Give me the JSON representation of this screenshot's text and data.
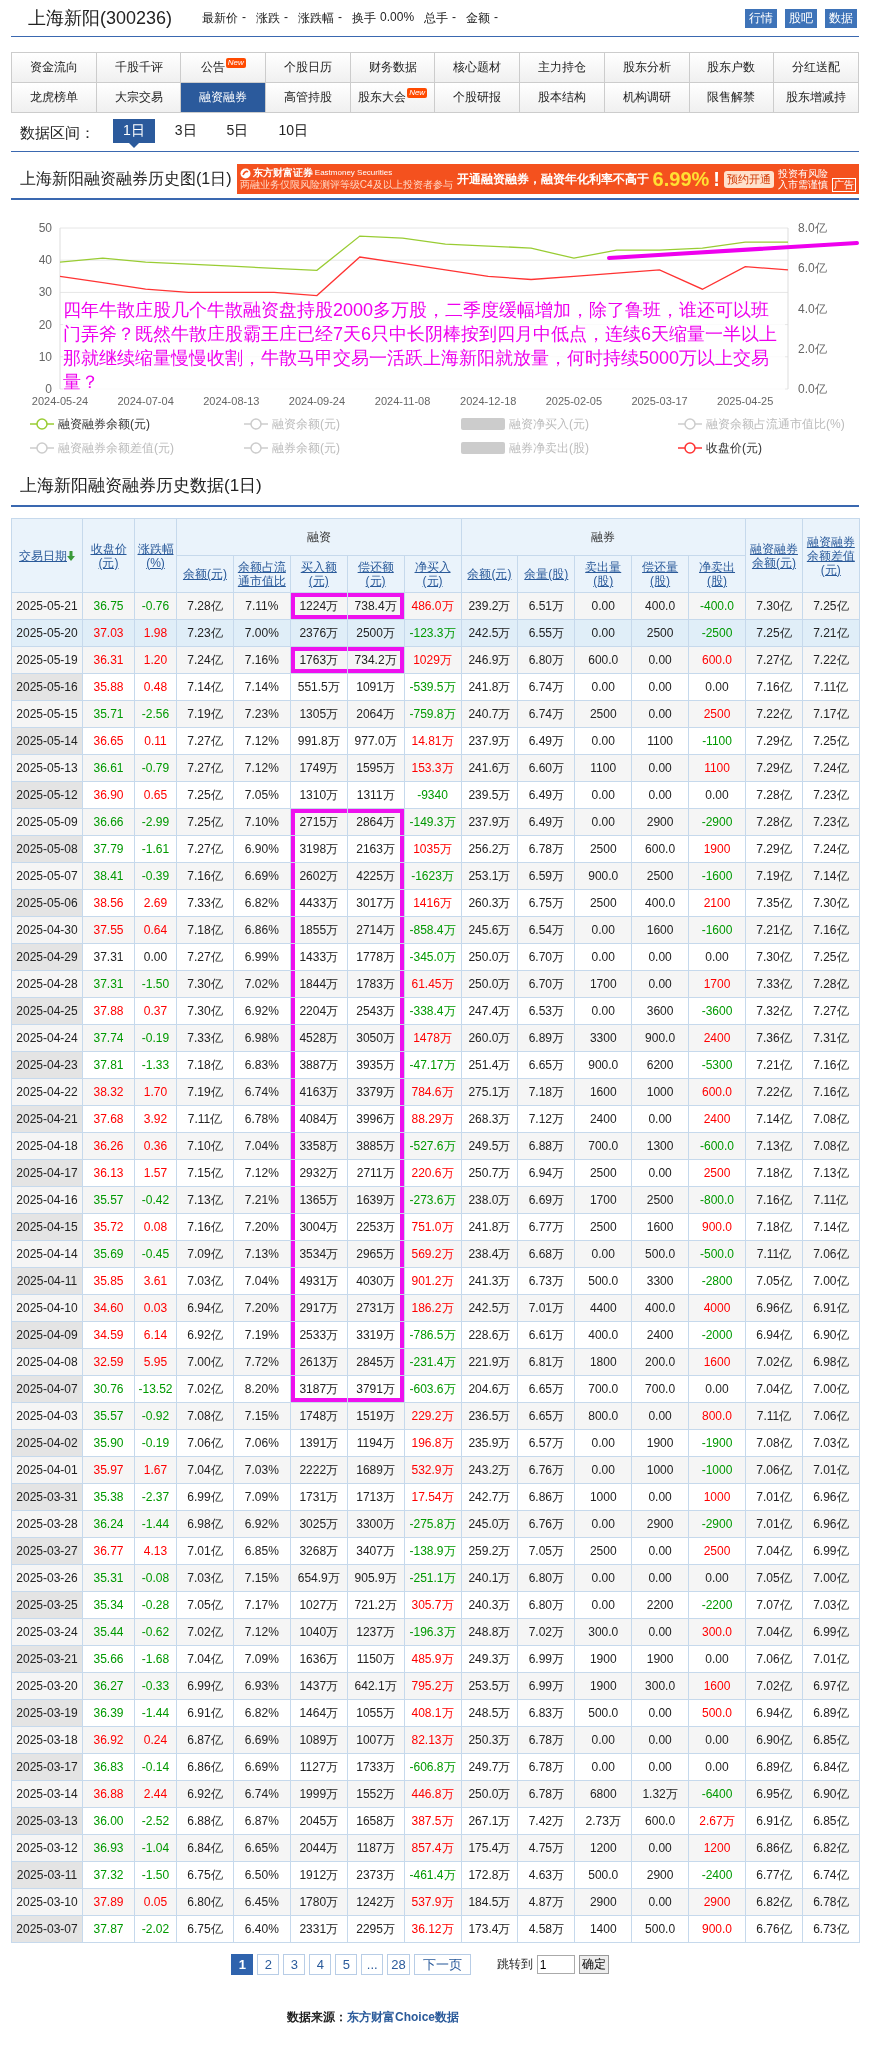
{
  "stock": {
    "name": "上海新阳(300236)",
    "quotes": [
      {
        "label": "最新价",
        "value": "-"
      },
      {
        "label": "涨跌",
        "value": "-"
      },
      {
        "label": "涨跌幅",
        "value": "-"
      },
      {
        "label": "换手",
        "value": "0.00%"
      },
      {
        "label": "总手",
        "value": "-"
      },
      {
        "label": "金额",
        "value": "-"
      }
    ],
    "buttons": [
      "行情",
      "股吧",
      "数据"
    ]
  },
  "nav": [
    {
      "label": "资金流向",
      "selected": false
    },
    {
      "label": "千股千评",
      "selected": false
    },
    {
      "label": "公告",
      "badge": "New",
      "selected": false
    },
    {
      "label": "个股日历",
      "selected": false
    },
    {
      "label": "财务数据",
      "selected": false
    },
    {
      "label": "核心题材",
      "selected": false
    },
    {
      "label": "主力持仓",
      "selected": false
    },
    {
      "label": "股东分析",
      "selected": false
    },
    {
      "label": "股东户数",
      "selected": false
    },
    {
      "label": "分红送配",
      "selected": false
    },
    {
      "label": "龙虎榜单",
      "selected": false
    },
    {
      "label": "大宗交易",
      "selected": false
    },
    {
      "label": "融资融券",
      "selected": true
    },
    {
      "label": "高管持股",
      "selected": false
    },
    {
      "label": "股东大会",
      "badge": "New",
      "selected": false
    },
    {
      "label": "个股研报",
      "selected": false
    },
    {
      "label": "股本结构",
      "selected": false
    },
    {
      "label": "机构调研",
      "selected": false
    },
    {
      "label": "限售解禁",
      "selected": false
    },
    {
      "label": "股东增减持",
      "selected": false
    }
  ],
  "period": {
    "label": "数据区间：",
    "options": [
      {
        "label": "1日",
        "selected": true
      },
      {
        "label": "3日",
        "selected": false
      },
      {
        "label": "5日",
        "selected": false
      },
      {
        "label": "10日",
        "selected": false
      }
    ]
  },
  "chart_section": {
    "title": "上海新阳融资融券历史图(1日)",
    "banner": {
      "brand": "东方财富证券",
      "brand_en": "Eastmoney Securities",
      "disclaimer": "两融业务仅限风险测评等级C4及以上投资者参与",
      "headline": "开通融资融券，融资年化利率不高于",
      "rate": "6.99%",
      "exclaim": "!",
      "button": "预约开通",
      "risk": [
        "投资有风险",
        "入市需谨慎"
      ],
      "tag": "广告"
    },
    "chart_data": {
      "type": "line",
      "grid": true,
      "categories": [
        "2024-05-24",
        null,
        "2024-07-04",
        null,
        "2024-08-13",
        null,
        "2024-09-24",
        null,
        "2024-11-08",
        null,
        "2024-12-18",
        null,
        "2025-02-05",
        null,
        "2025-03-17",
        null,
        "2025-04-25",
        null
      ],
      "ylim": [
        0,
        50
      ],
      "yticks": [
        0,
        10,
        20,
        30,
        40,
        50
      ],
      "y2lim": [
        0,
        8
      ],
      "y2ticks": [
        {
          "value": 0,
          "label": "0.0亿"
        },
        {
          "value": 2,
          "label": "2.0亿"
        },
        {
          "value": 4,
          "label": "4.0亿"
        },
        {
          "value": 6,
          "label": "6.0亿"
        },
        {
          "value": 8,
          "label": "8.0亿"
        }
      ],
      "series": [
        {
          "color": "#99cc33",
          "axis": "y2",
          "values": [
            6.3,
            6.5,
            6.3,
            6.2,
            6.1,
            6.0,
            5.9,
            7.6,
            7.5,
            7.2,
            7.1,
            7.0,
            6.5,
            6.9,
            6.9,
            7.0,
            7.3,
            7.3
          ]
        },
        {
          "color": "#ff3333",
          "values": [
            35,
            33,
            31,
            30,
            30,
            30,
            29,
            41,
            39,
            37,
            35,
            34,
            35,
            36,
            37,
            31,
            38,
            37
          ]
        }
      ]
    },
    "note": "四年牛散庄股几个牛散融资盘持股2000多万股，二季度缓幅增加，除了鲁班，谁还可以班门弄斧？既然牛散庄股霸王庄已经7天6只中长阴棒按到四月中低点，连续6天缩量一半以上那就继续缩量慢慢收割，牛散马甲交易一活跃上海新阳就放量，何时持续5000万以上交易量？",
    "legend": [
      {
        "label": "融资融券余额(元)",
        "kind": "line",
        "on": true,
        "color": "#99cc33"
      },
      {
        "label": "融资余额(元)",
        "kind": "line",
        "on": false
      },
      {
        "label": "融资净买入(元)",
        "kind": "bar",
        "on": false
      },
      {
        "label": "融资余额占流通市值比(%)",
        "kind": "line",
        "on": false
      },
      {
        "label": "融资融券余额差值(元)",
        "kind": "line",
        "on": false
      },
      {
        "label": "融券余额(元)",
        "kind": "line",
        "on": false
      },
      {
        "label": "融券净卖出(股)",
        "kind": "bar",
        "on": false
      },
      {
        "label": "收盘价(元)",
        "kind": "line",
        "on": true,
        "color": "#ff3333"
      }
    ]
  },
  "table_section": {
    "title": "上海新阳融资融券历史数据(1日)",
    "columns": [
      {
        "label": "交易日期",
        "kind": "link",
        "sorted": true
      },
      {
        "label": "收盘价(元)",
        "kind": "link",
        "sorted": false
      },
      {
        "label": "涨跌幅(%)",
        "kind": "link",
        "sorted": false
      },
      {
        "label": "融资",
        "kind": "group",
        "children": [
          {
            "label": "余额(元)",
            "kind": "link",
            "sorted": false
          },
          {
            "label": "余额占流通市值比",
            "kind": "link",
            "sorted": false
          },
          {
            "label": "买入额(元)",
            "kind": "link",
            "sorted": false
          },
          {
            "label": "偿还额(元)",
            "kind": "link",
            "sorted": false
          },
          {
            "label": "净买入(元)",
            "kind": "link",
            "sorted": false
          }
        ]
      },
      {
        "label": "融券",
        "kind": "group",
        "children": [
          {
            "label": "余额(元)",
            "kind": "link",
            "sorted": false
          },
          {
            "label": "余量(股)",
            "kind": "link",
            "sorted": false
          },
          {
            "label": "卖出量(股)",
            "kind": "link",
            "sorted": false
          },
          {
            "label": "偿还量(股)",
            "kind": "link",
            "sorted": false
          },
          {
            "label": "净卖出(股)",
            "kind": "link",
            "sorted": false
          }
        ]
      },
      {
        "label": "融资融券余额(元)",
        "kind": "link",
        "sorted": false
      },
      {
        "label": "融资融券余额差值(元)",
        "kind": "link",
        "sorted": false
      }
    ],
    "rows": [
      {
        "date": "2025-05-21",
        "close": "36.75",
        "change": "-0.76",
        "color": "#009900",
        "fin_balance": "7.28亿",
        "fin_ratio": "7.11%",
        "buy": "1224万",
        "repay": "738.4万",
        "net_buy": {
          "value": "486.0万",
          "color": "#ff0000"
        },
        "sl_balance": "239.2万",
        "sl_volume": "6.51万",
        "sell": "0.00",
        "sl_repay": "400.0",
        "net_sell": {
          "value": "-400.0",
          "color": "#009900"
        },
        "total": "7.30亿",
        "diff": "7.25亿",
        "boxed": true,
        "selected": false
      },
      {
        "date": "2025-05-20",
        "close": "37.03",
        "change": "1.98",
        "color": "#ff0000",
        "fin_balance": "7.23亿",
        "fin_ratio": "7.00%",
        "buy": "2376万",
        "repay": "2500万",
        "net_buy": {
          "value": "-123.3万",
          "color": "#009900"
        },
        "sl_balance": "242.5万",
        "sl_volume": "6.55万",
        "sell": "0.00",
        "sl_repay": "2500",
        "net_sell": {
          "value": "-2500",
          "color": "#009900"
        },
        "total": "7.25亿",
        "diff": "7.21亿",
        "boxed": false,
        "selected": true
      },
      {
        "date": "2025-05-19",
        "close": "36.31",
        "change": "1.20",
        "color": "#ff0000",
        "fin_balance": "7.24亿",
        "fin_ratio": "7.16%",
        "buy": "1763万",
        "repay": "734.2万",
        "net_buy": {
          "value": "1029万",
          "color": "#ff0000"
        },
        "sl_balance": "246.9万",
        "sl_volume": "6.80万",
        "sell": "600.0",
        "sl_repay": "0.00",
        "net_sell": {
          "value": "600.0",
          "color": "#ff0000"
        },
        "total": "7.27亿",
        "diff": "7.22亿",
        "boxed": true,
        "selected": false
      },
      {
        "date": "2025-05-16",
        "close": "35.88",
        "change": "0.48",
        "color": "#ff0000",
        "fin_balance": "7.14亿",
        "fin_ratio": "7.14%",
        "buy": "551.5万",
        "repay": "1091万",
        "net_buy": {
          "value": "-539.5万",
          "color": "#009900"
        },
        "sl_balance": "241.8万",
        "sl_volume": "6.74万",
        "sell": "0.00",
        "sl_repay": "0.00",
        "net_sell": {
          "value": "0.00",
          "color": "#222222"
        },
        "total": "7.16亿",
        "diff": "7.11亿",
        "boxed": false,
        "selected": false
      },
      {
        "date": "2025-05-15",
        "close": "35.71",
        "change": "-2.56",
        "color": "#009900",
        "fin_balance": "7.19亿",
        "fin_ratio": "7.23%",
        "buy": "1305万",
        "repay": "2064万",
        "net_buy": {
          "value": "-759.8万",
          "color": "#009900"
        },
        "sl_balance": "240.7万",
        "sl_volume": "6.74万",
        "sell": "2500",
        "sl_repay": "0.00",
        "net_sell": {
          "value": "2500",
          "color": "#ff0000"
        },
        "total": "7.22亿",
        "diff": "7.17亿",
        "boxed": false,
        "selected": false
      },
      {
        "date": "2025-05-14",
        "close": "36.65",
        "change": "0.11",
        "color": "#ff0000",
        "fin_balance": "7.27亿",
        "fin_ratio": "7.12%",
        "buy": "991.8万",
        "repay": "977.0万",
        "net_buy": {
          "value": "14.81万",
          "color": "#ff0000"
        },
        "sl_balance": "237.9万",
        "sl_volume": "6.49万",
        "sell": "0.00",
        "sl_repay": "1100",
        "net_sell": {
          "value": "-1100",
          "color": "#009900"
        },
        "total": "7.29亿",
        "diff": "7.25亿",
        "boxed": false,
        "selected": false
      },
      {
        "date": "2025-05-13",
        "close": "36.61",
        "change": "-0.79",
        "color": "#009900",
        "fin_balance": "7.27亿",
        "fin_ratio": "7.12%",
        "buy": "1749万",
        "repay": "1595万",
        "net_buy": {
          "value": "153.3万",
          "color": "#ff0000"
        },
        "sl_balance": "241.6万",
        "sl_volume": "6.60万",
        "sell": "1100",
        "sl_repay": "0.00",
        "net_sell": {
          "value": "1100",
          "color": "#ff0000"
        },
        "total": "7.29亿",
        "diff": "7.24亿",
        "boxed": false,
        "selected": false
      },
      {
        "date": "2025-05-12",
        "close": "36.90",
        "change": "0.65",
        "color": "#ff0000",
        "fin_balance": "7.25亿",
        "fin_ratio": "7.05%",
        "buy": "1310万",
        "repay": "1311万",
        "net_buy": {
          "value": "-9340",
          "color": "#009900"
        },
        "sl_balance": "239.5万",
        "sl_volume": "6.49万",
        "sell": "0.00",
        "sl_repay": "0.00",
        "net_sell": {
          "value": "0.00",
          "color": "#222222"
        },
        "total": "7.28亿",
        "diff": "7.23亿",
        "boxed": false,
        "selected": false
      },
      {
        "date": "2025-05-09",
        "close": "36.66",
        "change": "-2.99",
        "color": "#009900",
        "fin_balance": "7.25亿",
        "fin_ratio": "7.10%",
        "buy": "2715万",
        "repay": "2864万",
        "net_buy": {
          "value": "-149.3万",
          "color": "#009900"
        },
        "sl_balance": "237.9万",
        "sl_volume": "6.49万",
        "sell": "0.00",
        "sl_repay": "2900",
        "net_sell": {
          "value": "-2900",
          "color": "#009900"
        },
        "total": "7.28亿",
        "diff": "7.23亿",
        "boxed": true,
        "selected": false
      },
      {
        "date": "2025-05-08",
        "close": "37.79",
        "change": "-1.61",
        "color": "#009900",
        "fin_balance": "7.27亿",
        "fin_ratio": "6.90%",
        "buy": "3198万",
        "repay": "2163万",
        "net_buy": {
          "value": "1035万",
          "color": "#ff0000"
        },
        "sl_balance": "256.2万",
        "sl_volume": "6.78万",
        "sell": "2500",
        "sl_repay": "600.0",
        "net_sell": {
          "value": "1900",
          "color": "#ff0000"
        },
        "total": "7.29亿",
        "diff": "7.24亿",
        "boxed": true,
        "selected": false
      },
      {
        "date": "2025-05-07",
        "close": "38.41",
        "change": "-0.39",
        "color": "#009900",
        "fin_balance": "7.16亿",
        "fin_ratio": "6.69%",
        "buy": "2602万",
        "repay": "4225万",
        "net_buy": {
          "value": "-1623万",
          "color": "#009900"
        },
        "sl_balance": "253.1万",
        "sl_volume": "6.59万",
        "sell": "900.0",
        "sl_repay": "2500",
        "net_sell": {
          "value": "-1600",
          "color": "#009900"
        },
        "total": "7.19亿",
        "diff": "7.14亿",
        "boxed": true,
        "selected": false
      },
      {
        "date": "2025-05-06",
        "close": "38.56",
        "change": "2.69",
        "color": "#ff0000",
        "fin_balance": "7.33亿",
        "fin_ratio": "6.82%",
        "buy": "4433万",
        "repay": "3017万",
        "net_buy": {
          "value": "1416万",
          "color": "#ff0000"
        },
        "sl_balance": "260.3万",
        "sl_volume": "6.75万",
        "sell": "2500",
        "sl_repay": "400.0",
        "net_sell": {
          "value": "2100",
          "color": "#ff0000"
        },
        "total": "7.35亿",
        "diff": "7.30亿",
        "boxed": true,
        "selected": false
      },
      {
        "date": "2025-04-30",
        "close": "37.55",
        "change": "0.64",
        "color": "#ff0000",
        "fin_balance": "7.18亿",
        "fin_ratio": "6.86%",
        "buy": "1855万",
        "repay": "2714万",
        "net_buy": {
          "value": "-858.4万",
          "color": "#009900"
        },
        "sl_balance": "245.6万",
        "sl_volume": "6.54万",
        "sell": "0.00",
        "sl_repay": "1600",
        "net_sell": {
          "value": "-1600",
          "color": "#009900"
        },
        "total": "7.21亿",
        "diff": "7.16亿",
        "boxed": true,
        "selected": false
      },
      {
        "date": "2025-04-29",
        "close": "37.31",
        "change": "0.00",
        "color": "#222222",
        "fin_balance": "7.27亿",
        "fin_ratio": "6.99%",
        "buy": "1433万",
        "repay": "1778万",
        "net_buy": {
          "value": "-345.0万",
          "color": "#009900"
        },
        "sl_balance": "250.0万",
        "sl_volume": "6.70万",
        "sell": "0.00",
        "sl_repay": "0.00",
        "net_sell": {
          "value": "0.00",
          "color": "#222222"
        },
        "total": "7.30亿",
        "diff": "7.25亿",
        "boxed": true,
        "selected": false
      },
      {
        "date": "2025-04-28",
        "close": "37.31",
        "change": "-1.50",
        "color": "#009900",
        "fin_balance": "7.30亿",
        "fin_ratio": "7.02%",
        "buy": "1844万",
        "repay": "1783万",
        "net_buy": {
          "value": "61.45万",
          "color": "#ff0000"
        },
        "sl_balance": "250.0万",
        "sl_volume": "6.70万",
        "sell": "1700",
        "sl_repay": "0.00",
        "net_sell": {
          "value": "1700",
          "color": "#ff0000"
        },
        "total": "7.33亿",
        "diff": "7.28亿",
        "boxed": true,
        "selected": false
      },
      {
        "date": "2025-04-25",
        "close": "37.88",
        "change": "0.37",
        "color": "#ff0000",
        "fin_balance": "7.30亿",
        "fin_ratio": "6.92%",
        "buy": "2204万",
        "repay": "2543万",
        "net_buy": {
          "value": "-338.4万",
          "color": "#009900"
        },
        "sl_balance": "247.4万",
        "sl_volume": "6.53万",
        "sell": "0.00",
        "sl_repay": "3600",
        "net_sell": {
          "value": "-3600",
          "color": "#009900"
        },
        "total": "7.32亿",
        "diff": "7.27亿",
        "boxed": true,
        "selected": false
      },
      {
        "date": "2025-04-24",
        "close": "37.74",
        "change": "-0.19",
        "color": "#009900",
        "fin_balance": "7.33亿",
        "fin_ratio": "6.98%",
        "buy": "4528万",
        "repay": "3050万",
        "net_buy": {
          "value": "1478万",
          "color": "#ff0000"
        },
        "sl_balance": "260.0万",
        "sl_volume": "6.89万",
        "sell": "3300",
        "sl_repay": "900.0",
        "net_sell": {
          "value": "2400",
          "color": "#ff0000"
        },
        "total": "7.36亿",
        "diff": "7.31亿",
        "boxed": true,
        "selected": false
      },
      {
        "date": "2025-04-23",
        "close": "37.81",
        "change": "-1.33",
        "color": "#009900",
        "fin_balance": "7.18亿",
        "fin_ratio": "6.83%",
        "buy": "3887万",
        "repay": "3935万",
        "net_buy": {
          "value": "-47.17万",
          "color": "#009900"
        },
        "sl_balance": "251.4万",
        "sl_volume": "6.65万",
        "sell": "900.0",
        "sl_repay": "6200",
        "net_sell": {
          "value": "-5300",
          "color": "#009900"
        },
        "total": "7.21亿",
        "diff": "7.16亿",
        "boxed": true,
        "selected": false
      },
      {
        "date": "2025-04-22",
        "close": "38.32",
        "change": "1.70",
        "color": "#ff0000",
        "fin_balance": "7.19亿",
        "fin_ratio": "6.74%",
        "buy": "4163万",
        "repay": "3379万",
        "net_buy": {
          "value": "784.6万",
          "color": "#ff0000"
        },
        "sl_balance": "275.1万",
        "sl_volume": "7.18万",
        "sell": "1600",
        "sl_repay": "1000",
        "net_sell": {
          "value": "600.0",
          "color": "#ff0000"
        },
        "total": "7.22亿",
        "diff": "7.16亿",
        "boxed": true,
        "selected": false
      },
      {
        "date": "2025-04-21",
        "close": "37.68",
        "change": "3.92",
        "color": "#ff0000",
        "fin_balance": "7.11亿",
        "fin_ratio": "6.78%",
        "buy": "4084万",
        "repay": "3996万",
        "net_buy": {
          "value": "88.29万",
          "color": "#ff0000"
        },
        "sl_balance": "268.3万",
        "sl_volume": "7.12万",
        "sell": "2400",
        "sl_repay": "0.00",
        "net_sell": {
          "value": "2400",
          "color": "#ff0000"
        },
        "total": "7.14亿",
        "diff": "7.08亿",
        "boxed": true,
        "selected": false
      },
      {
        "date": "2025-04-18",
        "close": "36.26",
        "change": "0.36",
        "color": "#ff0000",
        "fin_balance": "7.10亿",
        "fin_ratio": "7.04%",
        "buy": "3358万",
        "repay": "3885万",
        "net_buy": {
          "value": "-527.6万",
          "color": "#009900"
        },
        "sl_balance": "249.5万",
        "sl_volume": "6.88万",
        "sell": "700.0",
        "sl_repay": "1300",
        "net_sell": {
          "value": "-600.0",
          "color": "#009900"
        },
        "total": "7.13亿",
        "diff": "7.08亿",
        "boxed": true,
        "selected": false
      },
      {
        "date": "2025-04-17",
        "close": "36.13",
        "change": "1.57",
        "color": "#ff0000",
        "fin_balance": "7.15亿",
        "fin_ratio": "7.12%",
        "buy": "2932万",
        "repay": "2711万",
        "net_buy": {
          "value": "220.6万",
          "color": "#ff0000"
        },
        "sl_balance": "250.7万",
        "sl_volume": "6.94万",
        "sell": "2500",
        "sl_repay": "0.00",
        "net_sell": {
          "value": "2500",
          "color": "#ff0000"
        },
        "total": "7.18亿",
        "diff": "7.13亿",
        "boxed": true,
        "selected": false
      },
      {
        "date": "2025-04-16",
        "close": "35.57",
        "change": "-0.42",
        "color": "#009900",
        "fin_balance": "7.13亿",
        "fin_ratio": "7.21%",
        "buy": "1365万",
        "repay": "1639万",
        "net_buy": {
          "value": "-273.6万",
          "color": "#009900"
        },
        "sl_balance": "238.0万",
        "sl_volume": "6.69万",
        "sell": "1700",
        "sl_repay": "2500",
        "net_sell": {
          "value": "-800.0",
          "color": "#009900"
        },
        "total": "7.16亿",
        "diff": "7.11亿",
        "boxed": true,
        "selected": false
      },
      {
        "date": "2025-04-15",
        "close": "35.72",
        "change": "0.08",
        "color": "#ff0000",
        "fin_balance": "7.16亿",
        "fin_ratio": "7.20%",
        "buy": "3004万",
        "repay": "2253万",
        "net_buy": {
          "value": "751.0万",
          "color": "#ff0000"
        },
        "sl_balance": "241.8万",
        "sl_volume": "6.77万",
        "sell": "2500",
        "sl_repay": "1600",
        "net_sell": {
          "value": "900.0",
          "color": "#ff0000"
        },
        "total": "7.18亿",
        "diff": "7.14亿",
        "boxed": true,
        "selected": false
      },
      {
        "date": "2025-04-14",
        "close": "35.69",
        "change": "-0.45",
        "color": "#009900",
        "fin_balance": "7.09亿",
        "fin_ratio": "7.13%",
        "buy": "3534万",
        "repay": "2965万",
        "net_buy": {
          "value": "569.2万",
          "color": "#ff0000"
        },
        "sl_balance": "238.4万",
        "sl_volume": "6.68万",
        "sell": "0.00",
        "sl_repay": "500.0",
        "net_sell": {
          "value": "-500.0",
          "color": "#009900"
        },
        "total": "7.11亿",
        "diff": "7.06亿",
        "boxed": true,
        "selected": false
      },
      {
        "date": "2025-04-11",
        "close": "35.85",
        "change": "3.61",
        "color": "#ff0000",
        "fin_balance": "7.03亿",
        "fin_ratio": "7.04%",
        "buy": "4931万",
        "repay": "4030万",
        "net_buy": {
          "value": "901.2万",
          "color": "#ff0000"
        },
        "sl_balance": "241.3万",
        "sl_volume": "6.73万",
        "sell": "500.0",
        "sl_repay": "3300",
        "net_sell": {
          "value": "-2800",
          "color": "#009900"
        },
        "total": "7.05亿",
        "diff": "7.00亿",
        "boxed": true,
        "selected": false
      },
      {
        "date": "2025-04-10",
        "close": "34.60",
        "change": "0.03",
        "color": "#ff0000",
        "fin_balance": "6.94亿",
        "fin_ratio": "7.20%",
        "buy": "2917万",
        "repay": "2731万",
        "net_buy": {
          "value": "186.2万",
          "color": "#ff0000"
        },
        "sl_balance": "242.5万",
        "sl_volume": "7.01万",
        "sell": "4400",
        "sl_repay": "400.0",
        "net_sell": {
          "value": "4000",
          "color": "#ff0000"
        },
        "total": "6.96亿",
        "diff": "6.91亿",
        "boxed": true,
        "selected": false
      },
      {
        "date": "2025-04-09",
        "close": "34.59",
        "change": "6.14",
        "color": "#ff0000",
        "fin_balance": "6.92亿",
        "fin_ratio": "7.19%",
        "buy": "2533万",
        "repay": "3319万",
        "net_buy": {
          "value": "-786.5万",
          "color": "#009900"
        },
        "sl_balance": "228.6万",
        "sl_volume": "6.61万",
        "sell": "400.0",
        "sl_repay": "2400",
        "net_sell": {
          "value": "-2000",
          "color": "#009900"
        },
        "total": "6.94亿",
        "diff": "6.90亿",
        "boxed": true,
        "selected": false
      },
      {
        "date": "2025-04-08",
        "close": "32.59",
        "change": "5.95",
        "color": "#ff0000",
        "fin_balance": "7.00亿",
        "fin_ratio": "7.72%",
        "buy": "2613万",
        "repay": "2845万",
        "net_buy": {
          "value": "-231.4万",
          "color": "#009900"
        },
        "sl_balance": "221.9万",
        "sl_volume": "6.81万",
        "sell": "1800",
        "sl_repay": "200.0",
        "net_sell": {
          "value": "1600",
          "color": "#ff0000"
        },
        "total": "7.02亿",
        "diff": "6.98亿",
        "boxed": true,
        "selected": false
      },
      {
        "date": "2025-04-07",
        "close": "30.76",
        "change": "-13.52",
        "color": "#009900",
        "fin_balance": "7.02亿",
        "fin_ratio": "8.20%",
        "buy": "3187万",
        "repay": "3791万",
        "net_buy": {
          "value": "-603.6万",
          "color": "#009900"
        },
        "sl_balance": "204.6万",
        "sl_volume": "6.65万",
        "sell": "700.0",
        "sl_repay": "700.0",
        "net_sell": {
          "value": "0.00",
          "color": "#222222"
        },
        "total": "7.04亿",
        "diff": "7.00亿",
        "boxed": true,
        "selected": false
      },
      {
        "date": "2025-04-03",
        "close": "35.57",
        "change": "-0.92",
        "color": "#009900",
        "fin_balance": "7.08亿",
        "fin_ratio": "7.15%",
        "buy": "1748万",
        "repay": "1519万",
        "net_buy": {
          "value": "229.2万",
          "color": "#ff0000"
        },
        "sl_balance": "236.5万",
        "sl_volume": "6.65万",
        "sell": "800.0",
        "sl_repay": "0.00",
        "net_sell": {
          "value": "800.0",
          "color": "#ff0000"
        },
        "total": "7.11亿",
        "diff": "7.06亿",
        "boxed": false,
        "selected": false
      },
      {
        "date": "2025-04-02",
        "close": "35.90",
        "change": "-0.19",
        "color": "#009900",
        "fin_balance": "7.06亿",
        "fin_ratio": "7.06%",
        "buy": "1391万",
        "repay": "1194万",
        "net_buy": {
          "value": "196.8万",
          "color": "#ff0000"
        },
        "sl_balance": "235.9万",
        "sl_volume": "6.57万",
        "sell": "0.00",
        "sl_repay": "1900",
        "net_sell": {
          "value": "-1900",
          "color": "#009900"
        },
        "total": "7.08亿",
        "diff": "7.03亿",
        "boxed": false,
        "selected": false
      },
      {
        "date": "2025-04-01",
        "close": "35.97",
        "change": "1.67",
        "color": "#ff0000",
        "fin_balance": "7.04亿",
        "fin_ratio": "7.03%",
        "buy": "2222万",
        "repay": "1689万",
        "net_buy": {
          "value": "532.9万",
          "color": "#ff0000"
        },
        "sl_balance": "243.2万",
        "sl_volume": "6.76万",
        "sell": "0.00",
        "sl_repay": "1000",
        "net_sell": {
          "value": "-1000",
          "color": "#009900"
        },
        "total": "7.06亿",
        "diff": "7.01亿",
        "boxed": false,
        "selected": false
      },
      {
        "date": "2025-03-31",
        "close": "35.38",
        "change": "-2.37",
        "color": "#009900",
        "fin_balance": "6.99亿",
        "fin_ratio": "7.09%",
        "buy": "1731万",
        "repay": "1713万",
        "net_buy": {
          "value": "17.54万",
          "color": "#ff0000"
        },
        "sl_balance": "242.7万",
        "sl_volume": "6.86万",
        "sell": "1000",
        "sl_repay": "0.00",
        "net_sell": {
          "value": "1000",
          "color": "#ff0000"
        },
        "total": "7.01亿",
        "diff": "6.96亿",
        "boxed": false,
        "selected": false
      },
      {
        "date": "2025-03-28",
        "close": "36.24",
        "change": "-1.44",
        "color": "#009900",
        "fin_balance": "6.98亿",
        "fin_ratio": "6.92%",
        "buy": "3025万",
        "repay": "3300万",
        "net_buy": {
          "value": "-275.8万",
          "color": "#009900"
        },
        "sl_balance": "245.0万",
        "sl_volume": "6.76万",
        "sell": "0.00",
        "sl_repay": "2900",
        "net_sell": {
          "value": "-2900",
          "color": "#009900"
        },
        "total": "7.01亿",
        "diff": "6.96亿",
        "boxed": false,
        "selected": false
      },
      {
        "date": "2025-03-27",
        "close": "36.77",
        "change": "4.13",
        "color": "#ff0000",
        "fin_balance": "7.01亿",
        "fin_ratio": "6.85%",
        "buy": "3268万",
        "repay": "3407万",
        "net_buy": {
          "value": "-138.9万",
          "color": "#009900"
        },
        "sl_balance": "259.2万",
        "sl_volume": "7.05万",
        "sell": "2500",
        "sl_repay": "0.00",
        "net_sell": {
          "value": "2500",
          "color": "#ff0000"
        },
        "total": "7.04亿",
        "diff": "6.99亿",
        "boxed": false,
        "selected": false
      },
      {
        "date": "2025-03-26",
        "close": "35.31",
        "change": "-0.08",
        "color": "#009900",
        "fin_balance": "7.03亿",
        "fin_ratio": "7.15%",
        "buy": "654.9万",
        "repay": "905.9万",
        "net_buy": {
          "value": "-251.1万",
          "color": "#009900"
        },
        "sl_balance": "240.1万",
        "sl_volume": "6.80万",
        "sell": "0.00",
        "sl_repay": "0.00",
        "net_sell": {
          "value": "0.00",
          "color": "#222222"
        },
        "total": "7.05亿",
        "diff": "7.00亿",
        "boxed": false,
        "selected": false
      },
      {
        "date": "2025-03-25",
        "close": "35.34",
        "change": "-0.28",
        "color": "#009900",
        "fin_balance": "7.05亿",
        "fin_ratio": "7.17%",
        "buy": "1027万",
        "repay": "721.2万",
        "net_buy": {
          "value": "305.7万",
          "color": "#ff0000"
        },
        "sl_balance": "240.3万",
        "sl_volume": "6.80万",
        "sell": "0.00",
        "sl_repay": "2200",
        "net_sell": {
          "value": "-2200",
          "color": "#009900"
        },
        "total": "7.07亿",
        "diff": "7.03亿",
        "boxed": false,
        "selected": false
      },
      {
        "date": "2025-03-24",
        "close": "35.44",
        "change": "-0.62",
        "color": "#009900",
        "fin_balance": "7.02亿",
        "fin_ratio": "7.12%",
        "buy": "1040万",
        "repay": "1237万",
        "net_buy": {
          "value": "-196.3万",
          "color": "#009900"
        },
        "sl_balance": "248.8万",
        "sl_volume": "7.02万",
        "sell": "300.0",
        "sl_repay": "0.00",
        "net_sell": {
          "value": "300.0",
          "color": "#ff0000"
        },
        "total": "7.04亿",
        "diff": "6.99亿",
        "boxed": false,
        "selected": false
      },
      {
        "date": "2025-03-21",
        "close": "35.66",
        "change": "-1.68",
        "color": "#009900",
        "fin_balance": "7.04亿",
        "fin_ratio": "7.09%",
        "buy": "1636万",
        "repay": "1150万",
        "net_buy": {
          "value": "485.9万",
          "color": "#ff0000"
        },
        "sl_balance": "249.3万",
        "sl_volume": "6.99万",
        "sell": "1900",
        "sl_repay": "1900",
        "net_sell": {
          "value": "0.00",
          "color": "#222222"
        },
        "total": "7.06亿",
        "diff": "7.01亿",
        "boxed": false,
        "selected": false
      },
      {
        "date": "2025-03-20",
        "close": "36.27",
        "change": "-0.33",
        "color": "#009900",
        "fin_balance": "6.99亿",
        "fin_ratio": "6.93%",
        "buy": "1437万",
        "repay": "642.1万",
        "net_buy": {
          "value": "795.2万",
          "color": "#ff0000"
        },
        "sl_balance": "253.5万",
        "sl_volume": "6.99万",
        "sell": "1900",
        "sl_repay": "300.0",
        "net_sell": {
          "value": "1600",
          "color": "#ff0000"
        },
        "total": "7.02亿",
        "diff": "6.97亿",
        "boxed": false,
        "selected": false
      },
      {
        "date": "2025-03-19",
        "close": "36.39",
        "change": "-1.44",
        "color": "#009900",
        "fin_balance": "6.91亿",
        "fin_ratio": "6.82%",
        "buy": "1464万",
        "repay": "1055万",
        "net_buy": {
          "value": "408.1万",
          "color": "#ff0000"
        },
        "sl_balance": "248.5万",
        "sl_volume": "6.83万",
        "sell": "500.0",
        "sl_repay": "0.00",
        "net_sell": {
          "value": "500.0",
          "color": "#ff0000"
        },
        "total": "6.94亿",
        "diff": "6.89亿",
        "boxed": false,
        "selected": false
      },
      {
        "date": "2025-03-18",
        "close": "36.92",
        "change": "0.24",
        "color": "#ff0000",
        "fin_balance": "6.87亿",
        "fin_ratio": "6.69%",
        "buy": "1089万",
        "repay": "1007万",
        "net_buy": {
          "value": "82.13万",
          "color": "#ff0000"
        },
        "sl_balance": "250.3万",
        "sl_volume": "6.78万",
        "sell": "0.00",
        "sl_repay": "0.00",
        "net_sell": {
          "value": "0.00",
          "color": "#222222"
        },
        "total": "6.90亿",
        "diff": "6.85亿",
        "boxed": false,
        "selected": false
      },
      {
        "date": "2025-03-17",
        "close": "36.83",
        "change": "-0.14",
        "color": "#009900",
        "fin_balance": "6.86亿",
        "fin_ratio": "6.69%",
        "buy": "1127万",
        "repay": "1733万",
        "net_buy": {
          "value": "-606.8万",
          "color": "#009900"
        },
        "sl_balance": "249.7万",
        "sl_volume": "6.78万",
        "sell": "0.00",
        "sl_repay": "0.00",
        "net_sell": {
          "value": "0.00",
          "color": "#222222"
        },
        "total": "6.89亿",
        "diff": "6.84亿",
        "boxed": false,
        "selected": false
      },
      {
        "date": "2025-03-14",
        "close": "36.88",
        "change": "2.44",
        "color": "#ff0000",
        "fin_balance": "6.92亿",
        "fin_ratio": "6.74%",
        "buy": "1999万",
        "repay": "1552万",
        "net_buy": {
          "value": "446.8万",
          "color": "#ff0000"
        },
        "sl_balance": "250.0万",
        "sl_volume": "6.78万",
        "sell": "6800",
        "sl_repay": "1.32万",
        "net_sell": {
          "value": "-6400",
          "color": "#009900"
        },
        "total": "6.95亿",
        "diff": "6.90亿",
        "boxed": false,
        "selected": false
      },
      {
        "date": "2025-03-13",
        "close": "36.00",
        "change": "-2.52",
        "color": "#009900",
        "fin_balance": "6.88亿",
        "fin_ratio": "6.87%",
        "buy": "2045万",
        "repay": "1658万",
        "net_buy": {
          "value": "387.5万",
          "color": "#ff0000"
        },
        "sl_balance": "267.1万",
        "sl_volume": "7.42万",
        "sell": "2.73万",
        "sl_repay": "600.0",
        "net_sell": {
          "value": "2.67万",
          "color": "#ff0000"
        },
        "total": "6.91亿",
        "diff": "6.85亿",
        "boxed": false,
        "selected": false
      },
      {
        "date": "2025-03-12",
        "close": "36.93",
        "change": "-1.04",
        "color": "#009900",
        "fin_balance": "6.84亿",
        "fin_ratio": "6.65%",
        "buy": "2044万",
        "repay": "1187万",
        "net_buy": {
          "value": "857.4万",
          "color": "#ff0000"
        },
        "sl_balance": "175.4万",
        "sl_volume": "4.75万",
        "sell": "1200",
        "sl_repay": "0.00",
        "net_sell": {
          "value": "1200",
          "color": "#ff0000"
        },
        "total": "6.86亿",
        "diff": "6.82亿",
        "boxed": false,
        "selected": false
      },
      {
        "date": "2025-03-11",
        "close": "37.32",
        "change": "-1.50",
        "color": "#009900",
        "fin_balance": "6.75亿",
        "fin_ratio": "6.50%",
        "buy": "1912万",
        "repay": "2373万",
        "net_buy": {
          "value": "-461.4万",
          "color": "#009900"
        },
        "sl_balance": "172.8万",
        "sl_volume": "4.63万",
        "sell": "500.0",
        "sl_repay": "2900",
        "net_sell": {
          "value": "-2400",
          "color": "#009900"
        },
        "total": "6.77亿",
        "diff": "6.74亿",
        "boxed": false,
        "selected": false
      },
      {
        "date": "2025-03-10",
        "close": "37.89",
        "change": "0.05",
        "color": "#ff0000",
        "fin_balance": "6.80亿",
        "fin_ratio": "6.45%",
        "buy": "1780万",
        "repay": "1242万",
        "net_buy": {
          "value": "537.9万",
          "color": "#ff0000"
        },
        "sl_balance": "184.5万",
        "sl_volume": "4.87万",
        "sell": "2900",
        "sl_repay": "0.00",
        "net_sell": {
          "value": "2900",
          "color": "#ff0000"
        },
        "total": "6.82亿",
        "diff": "6.78亿",
        "boxed": false,
        "selected": false
      },
      {
        "date": "2025-03-07",
        "close": "37.87",
        "change": "-2.02",
        "color": "#009900",
        "fin_balance": "6.75亿",
        "fin_ratio": "6.40%",
        "buy": "2331万",
        "repay": "2295万",
        "net_buy": {
          "value": "36.12万",
          "color": "#ff0000"
        },
        "sl_balance": "173.4万",
        "sl_volume": "4.58万",
        "sell": "1400",
        "sl_repay": "500.0",
        "net_sell": {
          "value": "900.0",
          "color": "#ff0000"
        },
        "total": "6.76亿",
        "diff": "6.73亿",
        "boxed": false,
        "selected": false
      }
    ]
  },
  "pagination": {
    "pages": [
      {
        "label": "1",
        "selected": true
      },
      {
        "label": "2",
        "selected": false
      },
      {
        "label": "3",
        "selected": false
      },
      {
        "label": "4",
        "selected": false
      },
      {
        "label": "5",
        "selected": false
      },
      {
        "label": "...",
        "selected": false
      },
      {
        "label": "28",
        "selected": false
      }
    ],
    "next": "下一页",
    "jump_label": "跳转到",
    "jump_value": "1",
    "confirm": "确定"
  },
  "source": {
    "label": "数据来源：",
    "link": "东方财富Choice数据"
  }
}
